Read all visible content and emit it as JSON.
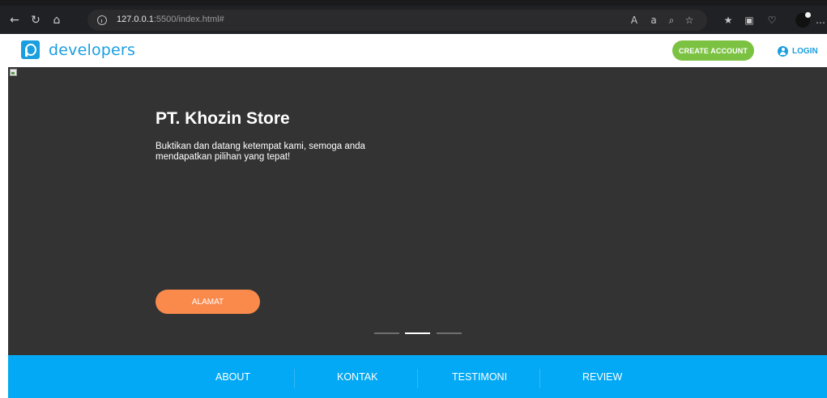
{
  "browser": {
    "url_host": "127.0.0.1",
    "url_path": ":5500/index.html#",
    "icons": [
      "back-icon",
      "refresh-icon",
      "home-icon",
      "info-icon",
      "read-aloud-icon",
      "translate-icon",
      "zoom-icon",
      "favorite-icon",
      "favorites-list-icon",
      "collections-icon",
      "health-icon",
      "profile-icon",
      "more-icon"
    ]
  },
  "header": {
    "brand_name": "developers",
    "create_account_label": "CREATE ACCOUNT",
    "login_label": "LOGIN",
    "colors": {
      "brand": "#1a9ee0",
      "create_account_bg": "#7cc242"
    }
  },
  "hero": {
    "title": "PT. Khozin Store",
    "text": "Buktikan dan datang ketempat kami, semoga anda mendapatkan pilihan yang tepat!",
    "button_label": "ALAMAT",
    "slide_count": 3,
    "active_slide": 2,
    "colors": {
      "background": "#333333",
      "button": "#f98a4c"
    }
  },
  "bottom_nav": {
    "items": [
      "ABOUT",
      "KONTAK",
      "TESTIMONI",
      "REVIEW"
    ],
    "colors": {
      "background": "#03a9f4"
    }
  }
}
